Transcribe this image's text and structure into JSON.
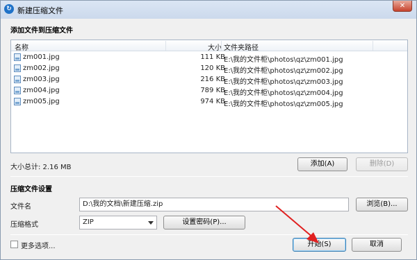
{
  "window": {
    "title": "新建压缩文件",
    "close_label": "✕"
  },
  "add_section": {
    "title": "添加文件到压缩文件"
  },
  "file_list": {
    "columns": {
      "name": "名称",
      "size": "大小",
      "folder": "文件夹路径"
    },
    "rows": [
      {
        "name": "zm001.jpg",
        "size": "111 KB",
        "folder": "E:\\我的文件柜\\photos\\qz\\zm001.jpg"
      },
      {
        "name": "zm002.jpg",
        "size": "120 KB",
        "folder": "E:\\我的文件柜\\photos\\qz\\zm002.jpg"
      },
      {
        "name": "zm003.jpg",
        "size": "216 KB",
        "folder": "E:\\我的文件柜\\photos\\qz\\zm003.jpg"
      },
      {
        "name": "zm004.jpg",
        "size": "789 KB",
        "folder": "E:\\我的文件柜\\photos\\qz\\zm004.jpg"
      },
      {
        "name": "zm005.jpg",
        "size": "974 KB",
        "folder": "E:\\我的文件柜\\photos\\qz\\zm005.jpg"
      }
    ]
  },
  "summary": {
    "total_size": "大小总计: 2.16 MB"
  },
  "list_buttons": {
    "add": "添加(A)",
    "delete": "删除(D)"
  },
  "settings": {
    "title": "压缩文件设置",
    "filename_label": "文件名",
    "filename_value": "D:\\我的文档\\新建压缩.zip",
    "browse": "浏览(B)...",
    "format_label": "压缩格式",
    "format_value": "ZIP",
    "password": "设置密码(P)..."
  },
  "footer": {
    "more_options": "更多选项...",
    "start": "开始(S)",
    "cancel": "取消"
  },
  "colors": {
    "accent": "#1f72c8",
    "arrow": "#e02020"
  }
}
